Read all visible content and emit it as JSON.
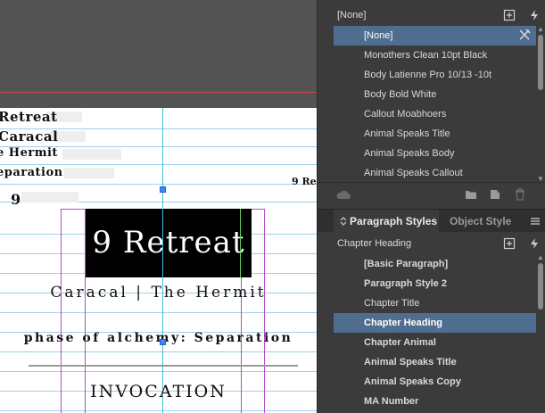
{
  "canvas": {
    "spread_lines": [
      "Retreat",
      "Caracal",
      "e Hermit",
      "eparation",
      "9"
    ],
    "side_label": "9 Re",
    "title": "9 Retreat",
    "subtitle": "Caracal | The Hermit",
    "phase_line": "phase of alchemy: Separation",
    "invocation": "INVOCATION"
  },
  "character_styles": {
    "current": "[None]",
    "items": [
      {
        "label": "[None]",
        "selected": true
      },
      {
        "label": "Monothers Clean 10pt Black"
      },
      {
        "label": "Body Latienne Pro 10/13 -10t"
      },
      {
        "label": "Body Bold White"
      },
      {
        "label": "Callout Moabhoers"
      },
      {
        "label": "Animal Speaks Title"
      },
      {
        "label": "Animal Speaks Body"
      },
      {
        "label": "Animal Speaks Callout"
      }
    ]
  },
  "tabs": {
    "paragraph": "Paragraph Styles",
    "object": "Object Style"
  },
  "paragraph_styles": {
    "current": "Chapter Heading",
    "items": [
      {
        "label": "[Basic Paragraph]"
      },
      {
        "label": "Paragraph Style 2"
      },
      {
        "label": "Chapter Title"
      },
      {
        "label": "Chapter Heading",
        "selected": true
      },
      {
        "label": "Chapter Animal"
      },
      {
        "label": "Animal Speaks Title"
      },
      {
        "label": "Animal Speaks Copy"
      },
      {
        "label": "MA Number"
      }
    ]
  },
  "colors": {
    "selection": "#4f6e8f",
    "panel_bg": "#3b3b3b",
    "guide": "#3fbfdc",
    "margin": "#b54ac9"
  }
}
